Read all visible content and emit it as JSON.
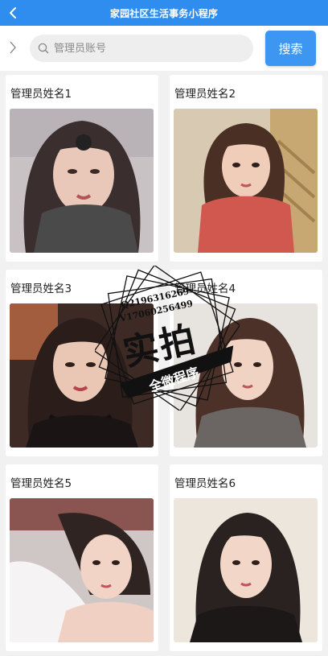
{
  "header": {
    "title": "家园社区生活事务小程序",
    "bg_color": "#2f8df0"
  },
  "search": {
    "placeholder": "管理员账号",
    "value": "",
    "button_label": "搜索"
  },
  "admins": [
    {
      "name": "管理员姓名1"
    },
    {
      "name": "管理员姓名2"
    },
    {
      "name": "管理员姓名3"
    },
    {
      "name": "管理员姓名4"
    },
    {
      "name": "管理员姓名5"
    },
    {
      "name": "管理员姓名6"
    }
  ],
  "watermark": {
    "line1": "Q2196316269",
    "line2": "V17060256499",
    "main": "实拍",
    "banner": "全微程序"
  }
}
